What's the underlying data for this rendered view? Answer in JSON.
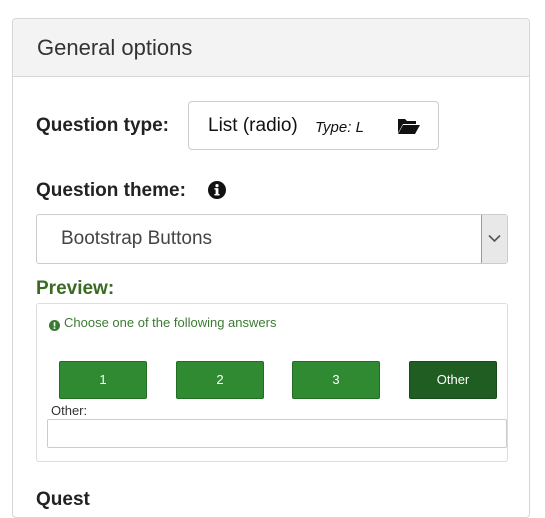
{
  "panel": {
    "title": "General options"
  },
  "question_type": {
    "label": "Question type:",
    "value_name": "List (radio)",
    "value_code": "Type: L",
    "icon": "folder-open-icon"
  },
  "question_theme": {
    "label": "Question theme:",
    "info_icon": "info-circle-icon",
    "selected": "Bootstrap Buttons"
  },
  "preview": {
    "label": "Preview:",
    "hint": "Choose one of the following answers",
    "answers": [
      "1",
      "2",
      "3",
      "Other"
    ],
    "active_answer": "Other",
    "other_label": "Other:",
    "other_value": ""
  },
  "next_section": {
    "partial_label": "Quest"
  },
  "colors": {
    "button_green": "#2f8a32",
    "button_active": "#1f5d22",
    "preview_label": "#3a6b22",
    "hint_text": "#3c7a33"
  }
}
